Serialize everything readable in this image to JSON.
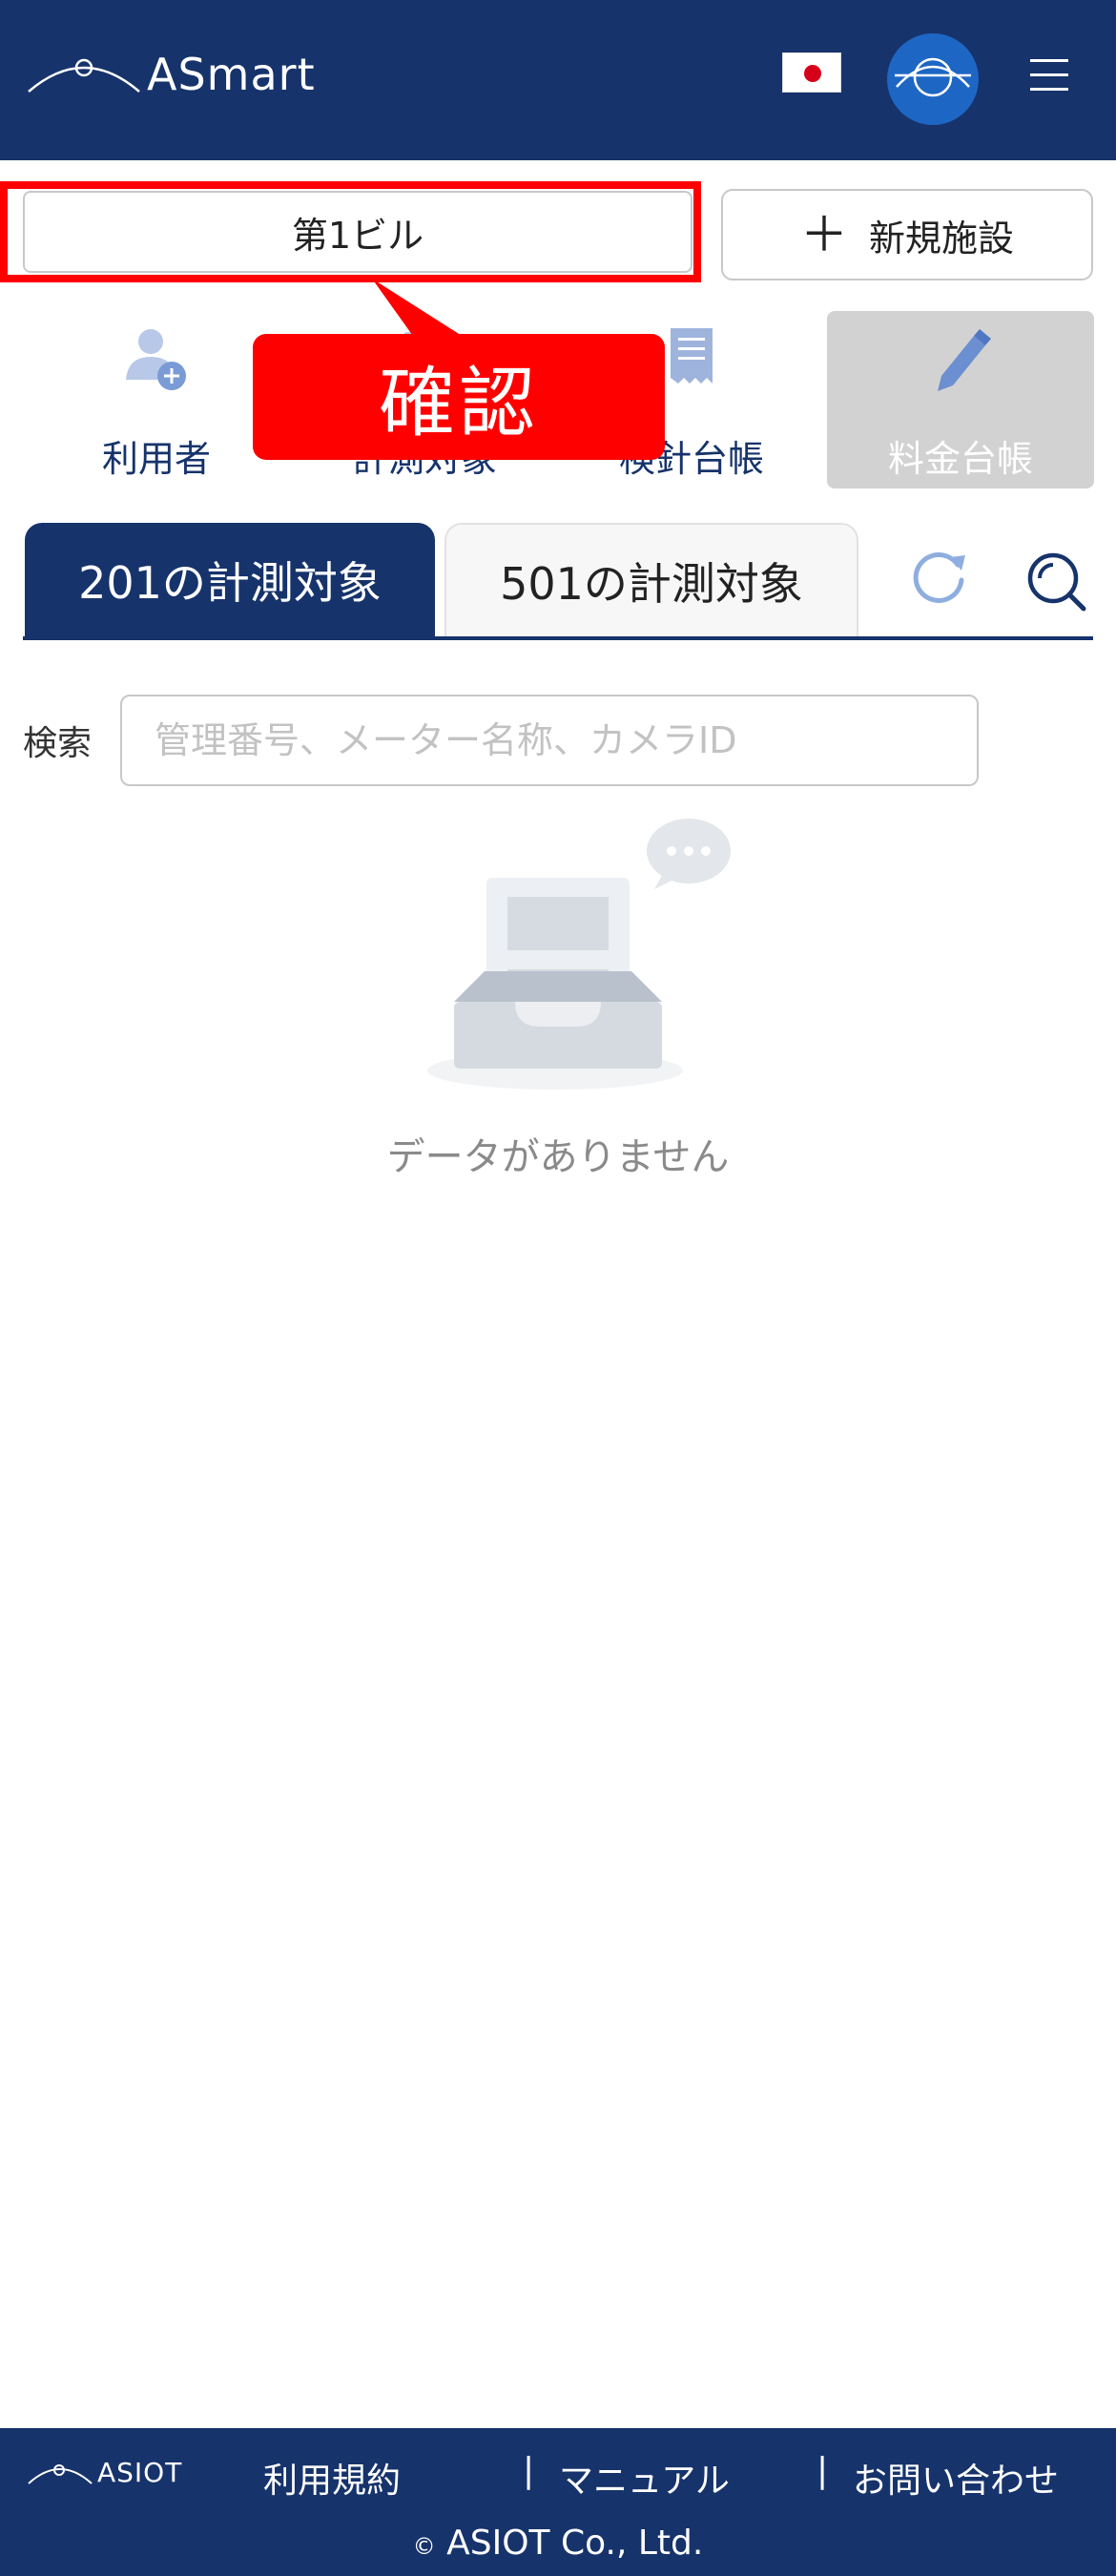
{
  "header": {
    "logo_text": "ASmart",
    "flag_icon": "japan-flag-icon",
    "avatar_icon": "globe-avatar-icon",
    "menu_icon": "hamburger-menu-icon",
    "background_color": "#16336b"
  },
  "facility": {
    "current": "第1ビル",
    "new_button_plus": "＋",
    "new_button_label": "新規施設"
  },
  "annotation": {
    "callout_text": "確認",
    "color": "#ff0000"
  },
  "nav": {
    "items": [
      {
        "label": "利用者",
        "icon": "add-user-icon",
        "active": false
      },
      {
        "label": "計測対象",
        "icon": "measurement-target-icon",
        "active": false
      },
      {
        "label": "検針台帳",
        "icon": "meter-ledger-icon",
        "active": false
      },
      {
        "label": "料金台帳",
        "icon": "pencil-icon",
        "active": true
      }
    ]
  },
  "tabs": {
    "items": [
      {
        "label": "201の計測対象",
        "active": true
      },
      {
        "label": "501の計測対象",
        "active": false
      }
    ],
    "refresh_icon": "refresh-icon",
    "search_icon": "search-icon"
  },
  "search": {
    "label": "検索",
    "value": "",
    "placeholder": "管理番号、メーター名称、カメラID"
  },
  "empty": {
    "icon": "empty-inbox-icon",
    "text": "データがありません"
  },
  "footer": {
    "logo_text": "ASIOT",
    "links": [
      "利用規約",
      "マニュアル",
      "お問い合わせ"
    ],
    "separator": "|",
    "copyright_symbol": "©",
    "copyright": "ASIOT Co., Ltd."
  }
}
